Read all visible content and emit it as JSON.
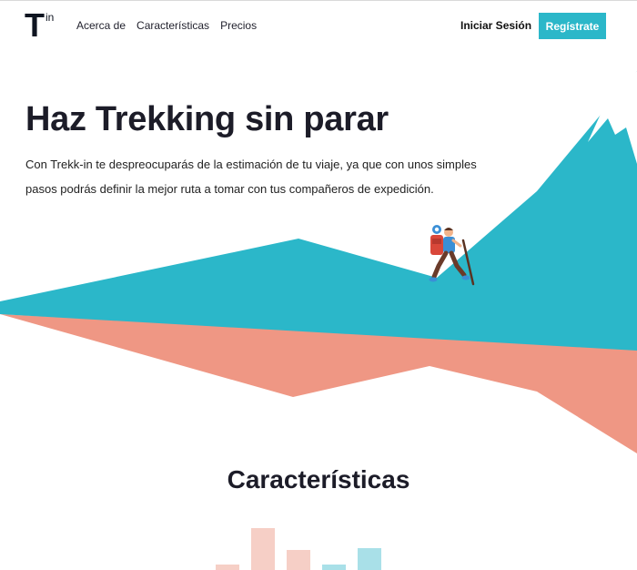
{
  "header": {
    "logo": {
      "letter": "T",
      "superscript": "in"
    },
    "nav": [
      {
        "label": "Acerca de"
      },
      {
        "label": "Características"
      },
      {
        "label": "Precios"
      }
    ],
    "login_label": "Iniciar Sesión",
    "signup_label": "Regístrate"
  },
  "hero": {
    "title": "Haz Trekking sin parar",
    "description": "Con Trekk-in te despreocuparás de la estimación de tu viaje, ya que con unos simples pasos podrás definir la mejor ruta a tomar con tus compañeros de expedición."
  },
  "features": {
    "title": "Características"
  },
  "colors": {
    "accent": "#2bb7c9",
    "salmon": "#ef9784",
    "dark": "#1c1c28"
  },
  "icons": [
    "hiker-illustration"
  ]
}
